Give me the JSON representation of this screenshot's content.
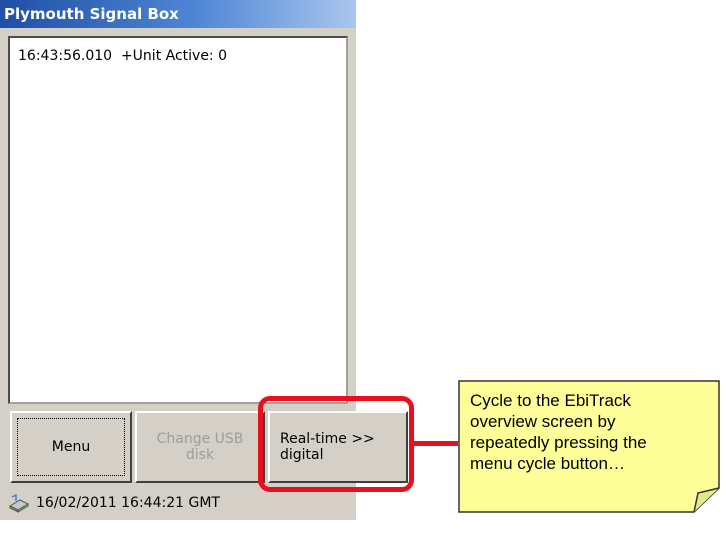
{
  "window": {
    "title": "Plymouth Signal Box",
    "log_lines": [
      "16:43:56.010  +Unit Active: 0"
    ],
    "buttons": {
      "menu": "Menu",
      "change_usb_line1": "Change USB",
      "change_usb_line2": "disk",
      "realtime_line1": "Real-time >>",
      "realtime_line2": "digital"
    },
    "status": {
      "icon": "usb-drive-icon",
      "datetime": "16/02/2011  16:44:21 GMT"
    }
  },
  "callout": {
    "text_line1": "Cycle to the EbiTrack",
    "text_line2": "overview screen by",
    "text_line3": "repeatedly pressing the",
    "text_line4": "menu cycle button…",
    "highlight_color": "#e8101c",
    "note_color": "#ffff99"
  }
}
